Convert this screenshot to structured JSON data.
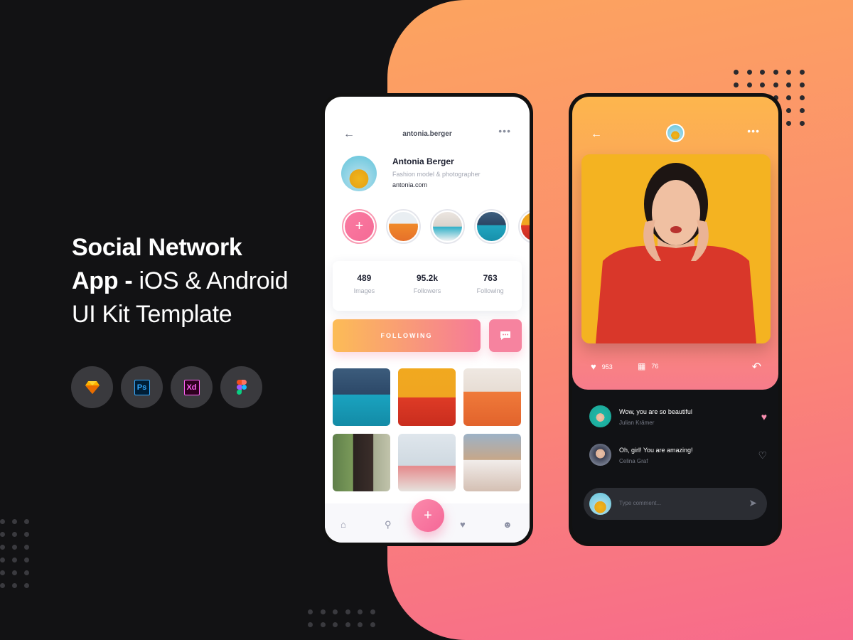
{
  "background": {
    "dark": "#121214",
    "gradient_from": "#fca45f",
    "gradient_to": "#f76a8c"
  },
  "headline": {
    "line1": "Social Network",
    "line2_bold": "App -",
    "line2_light": " iOS & Android",
    "line3": "UI Kit Template"
  },
  "tools": [
    {
      "name": "sketch-icon"
    },
    {
      "name": "photoshop-icon",
      "label": "Ps"
    },
    {
      "name": "xd-icon",
      "label": "Xd"
    },
    {
      "name": "figma-icon"
    }
  ],
  "profile_screen": {
    "header": {
      "username": "antonia.berger",
      "back_icon": "arrow-left-icon",
      "more_icon": "more-icon"
    },
    "profile": {
      "name": "Antonia Berger",
      "role": "Fashion model & photographer",
      "site": "antonia.com"
    },
    "stats": [
      {
        "value": "489",
        "label": "Images"
      },
      {
        "value": "95.2k",
        "label": "Followers"
      },
      {
        "value": "763",
        "label": "Following"
      }
    ],
    "follow_label": "FOLLOWING",
    "fab_label": "+",
    "story_add_label": "+",
    "tabs": [
      "home-icon",
      "search-icon",
      "heart-icon",
      "profile-icon"
    ]
  },
  "post_screen": {
    "likes": "953",
    "comments_count": "76",
    "comments": [
      {
        "text": "Wow, you are so beautiful",
        "author": "Julian Krämer",
        "liked": true
      },
      {
        "text": "Oh, girl! You are amazing!",
        "author": "Celina Graf",
        "liked": false
      }
    ],
    "comment_placeholder": "Type comment..."
  },
  "colors": {
    "accent_pink": "#f6839f",
    "accent_orange": "#fcbc56",
    "like_active": "#fa8fb0"
  }
}
